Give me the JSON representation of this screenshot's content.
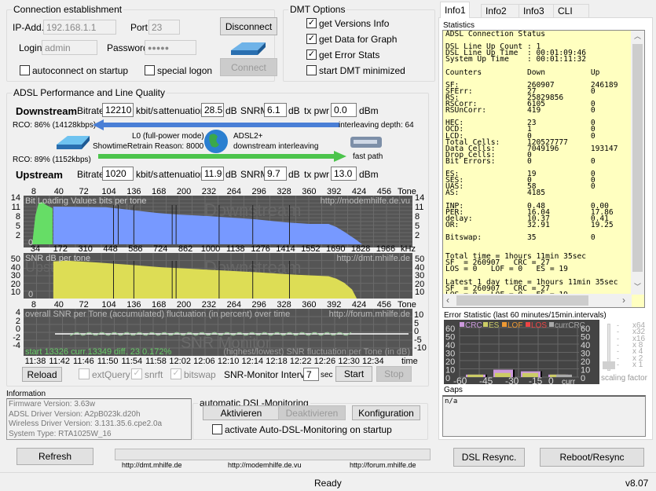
{
  "connection": {
    "title": "Connection establishment",
    "ip_label": "IP-Add.",
    "ip_value": "192.168.1.1",
    "port_label": "Port",
    "port_value": "23",
    "login_label": "Login",
    "login_value": "admin",
    "password_label": "Password",
    "password_value": "●●●●●",
    "autoconnect_label": "autoconnect on startup",
    "autoconnect_checked": false,
    "special_logon_label": "special logon",
    "special_logon_checked": false,
    "disconnect_label": "Disconnect",
    "connect_label": "Connect"
  },
  "dmt_options": {
    "title": "DMT Options",
    "items": [
      {
        "label": "get Versions Info",
        "checked": true
      },
      {
        "label": "get Data for Graph",
        "checked": true
      },
      {
        "label": "get Error Stats",
        "checked": true
      },
      {
        "label": "start DMT minimized",
        "checked": false
      }
    ]
  },
  "performance": {
    "title": "ADSL Performance and Line Quality",
    "downstream": {
      "label": "Downstream",
      "bitrate_label": "Bitrate",
      "bitrate": "12210",
      "bitrate_unit": "kbit/s",
      "att_label": "attenuation",
      "att": "28.5",
      "att_unit": "dB",
      "snrm_label": "SNRM",
      "snrm": "6.1",
      "snrm_unit": "dB",
      "txpwr_label": "tx pwr",
      "txpwr": "0.0",
      "txpwr_unit": "dBm",
      "rco": "RCO: 86% (14128kbps)"
    },
    "upstream": {
      "label": "Upstream",
      "bitrate_label": "Bitrate",
      "bitrate": "1020",
      "bitrate_unit": "kbit/s",
      "att_label": "attenuation",
      "att": "11.9",
      "att_unit": "dB",
      "snrm_label": "SNRM",
      "snrm": "9.7",
      "snrm_unit": "dB",
      "txpwr_label": "tx pwr",
      "txpwr": "13.0",
      "txpwr_unit": "dBm",
      "rco": "RCO: 89% (1152kbps)"
    },
    "interleaving_depth": "interleaving depth: 64",
    "power_mode": "L0 (full-power mode)",
    "retrain_reason": "ShowtimeRetrain Reason: 8000",
    "mode": "ADSL2+",
    "mode_detail": "downstream interleaving",
    "up_path": "fast path"
  },
  "charts": {
    "tone_ticks": [
      "8",
      "40",
      "72",
      "104",
      "136",
      "168",
      "200",
      "232",
      "264",
      "296",
      "328",
      "360",
      "392",
      "424",
      "456"
    ],
    "tone_unit": "Tone",
    "khz_ticks": [
      "34",
      "172",
      "310",
      "448",
      "586",
      "724",
      "862",
      "1000",
      "1138",
      "1276",
      "1414",
      "1552",
      "1690",
      "1828",
      "1966"
    ],
    "khz_unit": "kHz",
    "bitloading": {
      "title": "Bit Loading Values   bits per tone",
      "url": "http://modemhilfe.de.vu",
      "watermark_up": "Up",
      "watermark_down": "Downstream",
      "yticks": [
        "14",
        "11",
        "8",
        "5",
        "2"
      ],
      "zero": "0",
      "up_color": "#66dd66",
      "down_color": "#7799ff",
      "up_profile": [
        [
          6,
          0
        ],
        [
          10,
          9
        ],
        [
          14,
          13
        ],
        [
          18,
          13.5
        ],
        [
          24,
          12.5
        ],
        [
          32,
          11.5
        ]
      ],
      "down_profile": [
        [
          33,
          12
        ],
        [
          100,
          11.8
        ],
        [
          130,
          11
        ],
        [
          165,
          10
        ],
        [
          190,
          9.5
        ],
        [
          230,
          9
        ],
        [
          290,
          8
        ],
        [
          330,
          7
        ],
        [
          360,
          6.5
        ],
        [
          385,
          6.5
        ],
        [
          395,
          5.5
        ],
        [
          405,
          4
        ],
        [
          420,
          1.5
        ],
        [
          428,
          0
        ]
      ]
    },
    "snr": {
      "title": "SNR  dB per tone",
      "url": "http://dmt.mhilfe.de",
      "watermark_up": "Upstr",
      "watermark_down": "Downstream",
      "yticks": [
        "50",
        "40",
        "30",
        "20",
        "10"
      ],
      "zero": "0",
      "color": "#dddd55",
      "profile": [
        [
          33,
          45
        ],
        [
          50,
          46
        ],
        [
          100,
          43
        ],
        [
          130,
          41
        ],
        [
          170,
          38
        ],
        [
          230,
          35
        ],
        [
          290,
          32
        ],
        [
          340,
          29
        ],
        [
          385,
          27
        ],
        [
          395,
          24
        ],
        [
          405,
          19
        ],
        [
          415,
          11
        ],
        [
          421,
          0
        ]
      ]
    },
    "monitor": {
      "title": "overall SNR per Tone (accumulated) fluctuation (in percent) over time",
      "url": "http://forum.mhilfe.de",
      "watermark": "SNR Monitor",
      "left_yticks": [
        "4",
        "2",
        "0",
        "-2",
        "-4"
      ],
      "right_yticks": [
        "10",
        "5",
        "0",
        "-5",
        "-10"
      ],
      "status": "start 13326  curr.13349  diff. 23      0.172%",
      "legend": "(highest/lowest) SNR fluctuation per Tone (in dB)",
      "time_ticks": [
        "11:38",
        "11:42",
        "11:46",
        "11:50",
        "11:54",
        "11:58",
        "12:02",
        "12:06",
        "12:10",
        "12:14",
        "12:18",
        "12:22",
        "12:26",
        "12:30",
        "12:34"
      ],
      "time_unit": "time"
    }
  },
  "controls": {
    "reload": "Reload",
    "extquery_label": "extQuery",
    "extquery_checked": false,
    "snrft_label": "snrft",
    "snrft_checked": true,
    "bitswap_label": "bitswap",
    "bitswap_checked": true,
    "interval_label": "SNR-Monitor Interval:",
    "interval_value": "7",
    "interval_unit": "sec",
    "start": "Start",
    "stop": "Stop"
  },
  "information": {
    "title": "Information",
    "lines": [
      "Firmware Version: 3.63w",
      "ADSL Driver Version: A2pB023k.d20h",
      "Wireless Driver Version: 3.131.35.6.cpe2.0a",
      "System Type: RTA1025W_16"
    ]
  },
  "auto_monitoring": {
    "title": "automatic DSL-Monitoring",
    "activate": "Aktivieren",
    "deactivate": "Deaktivieren",
    "config": "Konfiguration",
    "startup_label": "activate Auto-DSL-Monitoring on startup",
    "startup_checked": false
  },
  "bottom": {
    "refresh": "Refresh",
    "links": [
      "http://dmt.mhilfe.de",
      "http://modemhilfe.de.vu",
      "http://forum.mhilfe.de"
    ],
    "progress": 0,
    "dsl_resync": "DSL Resync.",
    "reboot": "Reboot/Resync"
  },
  "status_bar": {
    "text": "Ready",
    "version": "v8.07"
  },
  "right_panel": {
    "tabs": [
      "Info1",
      "Info2",
      "Info3",
      "CLI"
    ],
    "active_tab": "Info1",
    "statistics_label": "Statistics",
    "statistics_text": "ADSL Connection Status\n\nDSL Line Up Count : 1\nDSL Line Up Time  : 00:01:09:46\nSystem Up Time    : 00:01:11:32\n\nCounters          Down          Up\n\nSF:               260907        246189\nSFErr:            27            0\nRS:               25829856\nRSCorr:           6105          0\nRSUnCorr:         419           0\n\nHEC:              23            0\nOCD:              1             0\nLCD:              0             0\nTotal Cells:      120527777\nData Cells:       7049196       193147\nDrop Cells:       0\nBit Errors:       0             0\n\nES:               19            0\nSES:              0             0\nUAS:              58            0\nAS:               4185\n\nINP:              0.48          0.00\nPER:              16.04         17.86\ndelay:            10.37         0.41\nOR:               32.91         19.25\n\nBitswap:          35            0\n\n\nTotal time = 1hours 11min 35sec\nSF  = 260907   CRC = 27\nLOS = 0   LOF = 0   ES = 19\n\nLatest 1 day time = 1hours 11min 35sec\nSF  = 260907   CRC = 27\nLOS = 0   LOF = 0   ES = 19",
    "error_stat": {
      "title": "Error Statistic (last 60 minutes/15min.intervals)",
      "legend": [
        {
          "name": "CRC",
          "color": "#cc99dd"
        },
        {
          "name": "ES",
          "color": "#cccc66"
        },
        {
          "name": "LOF",
          "color": "#ee9933"
        },
        {
          "name": "LOS",
          "color": "#ee4444"
        },
        {
          "name": "currCRC",
          "color": "#aaaaaa"
        }
      ],
      "yticks": [
        "60",
        "50",
        "40",
        "30",
        "20",
        "10",
        "0"
      ],
      "xticks": [
        "-60",
        "-45",
        "-30",
        "-15",
        "0",
        "curr"
      ],
      "intervals": [
        {
          "crc": 3,
          "es": 3
        },
        {
          "crc": 9,
          "es": 5
        },
        {
          "crc": 7,
          "es": 5
        },
        {
          "crc": 3,
          "es": 3
        }
      ],
      "curr_crc": 2
    },
    "scaling": {
      "label": "scaling factor",
      "options": [
        "x64",
        "x32",
        "x16",
        "x 8",
        "x 4",
        "x 2",
        "x 1"
      ],
      "selected": "x 1"
    },
    "gaps_label": "Gaps",
    "gaps_text": "n/a"
  }
}
